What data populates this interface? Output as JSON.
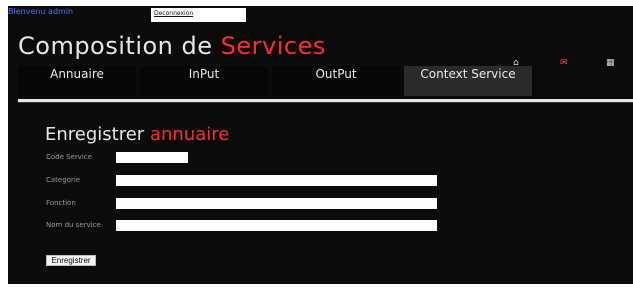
{
  "header": {
    "welcome_text": "Bienvenu",
    "username": "admin",
    "logout_label": "Deconnexion",
    "title_main": "Composition de",
    "title_accent": "Services",
    "icons": [
      "home-icon",
      "mail-icon",
      "grid-icon"
    ],
    "icon_glyphs": {
      "home": "⌂",
      "mail": "✉",
      "grid": "▦"
    }
  },
  "tabs": [
    {
      "label": "Annuaire"
    },
    {
      "label": "InPut"
    },
    {
      "label": "OutPut"
    },
    {
      "label": "Context Service",
      "active": true
    }
  ],
  "form": {
    "title_main": "Enregistrer",
    "title_accent": "annuaire",
    "fields": [
      {
        "label": "Code Service",
        "value": ""
      },
      {
        "label": "Categorie",
        "value": ""
      },
      {
        "label": "Fonction",
        "value": ""
      },
      {
        "label": "Nom du service",
        "value": ""
      }
    ],
    "submit_label": "Enregistrer"
  },
  "colors": {
    "background": "#0b0b0b",
    "accent": "#ff2b2b",
    "link": "#3a78ff"
  }
}
